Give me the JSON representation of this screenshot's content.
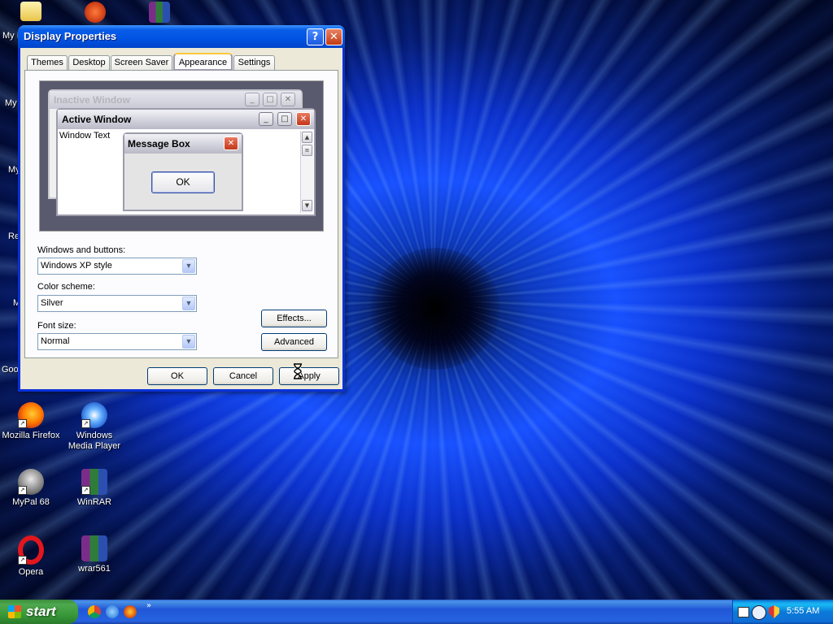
{
  "desktop": {
    "icons": [
      {
        "label": "Mozilla Firefox"
      },
      {
        "label": "Windows Media Player"
      },
      {
        "label": "MyPal 68"
      },
      {
        "label": "WinRAR"
      },
      {
        "label": "Opera"
      },
      {
        "label": "wrar561"
      }
    ],
    "edge_labels": [
      "My I",
      "My",
      "My",
      "Re",
      "M",
      "Goo"
    ]
  },
  "dialog": {
    "title": "Display Properties",
    "help_glyph": "?",
    "close_glyph": "✕",
    "tabs": [
      "Themes",
      "Desktop",
      "Screen Saver",
      "Appearance",
      "Settings"
    ],
    "active_tab": "Appearance",
    "preview": {
      "inactive_title": "Inactive Window",
      "active_title": "Active Window",
      "window_text": "Window Text",
      "message_title": "Message Box",
      "ok_label": "OK"
    },
    "windows_buttons_label": "Windows and buttons:",
    "windows_buttons_value": "Windows XP style",
    "color_scheme_label": "Color scheme:",
    "color_scheme_value": "Silver",
    "font_size_label": "Font size:",
    "font_size_value": "Normal",
    "effects_label": "Effects...",
    "advanced_label": "Advanced",
    "ok_label": "OK",
    "cancel_label": "Cancel",
    "apply_label": "Apply"
  },
  "taskbar": {
    "start_label": "start",
    "quicklaunch_more": "»",
    "clock": "5:55 AM"
  },
  "colors": {
    "titlebar": "#0054e3",
    "start_green": "#3a9a3a",
    "accent_tab": "#ffc83c"
  }
}
